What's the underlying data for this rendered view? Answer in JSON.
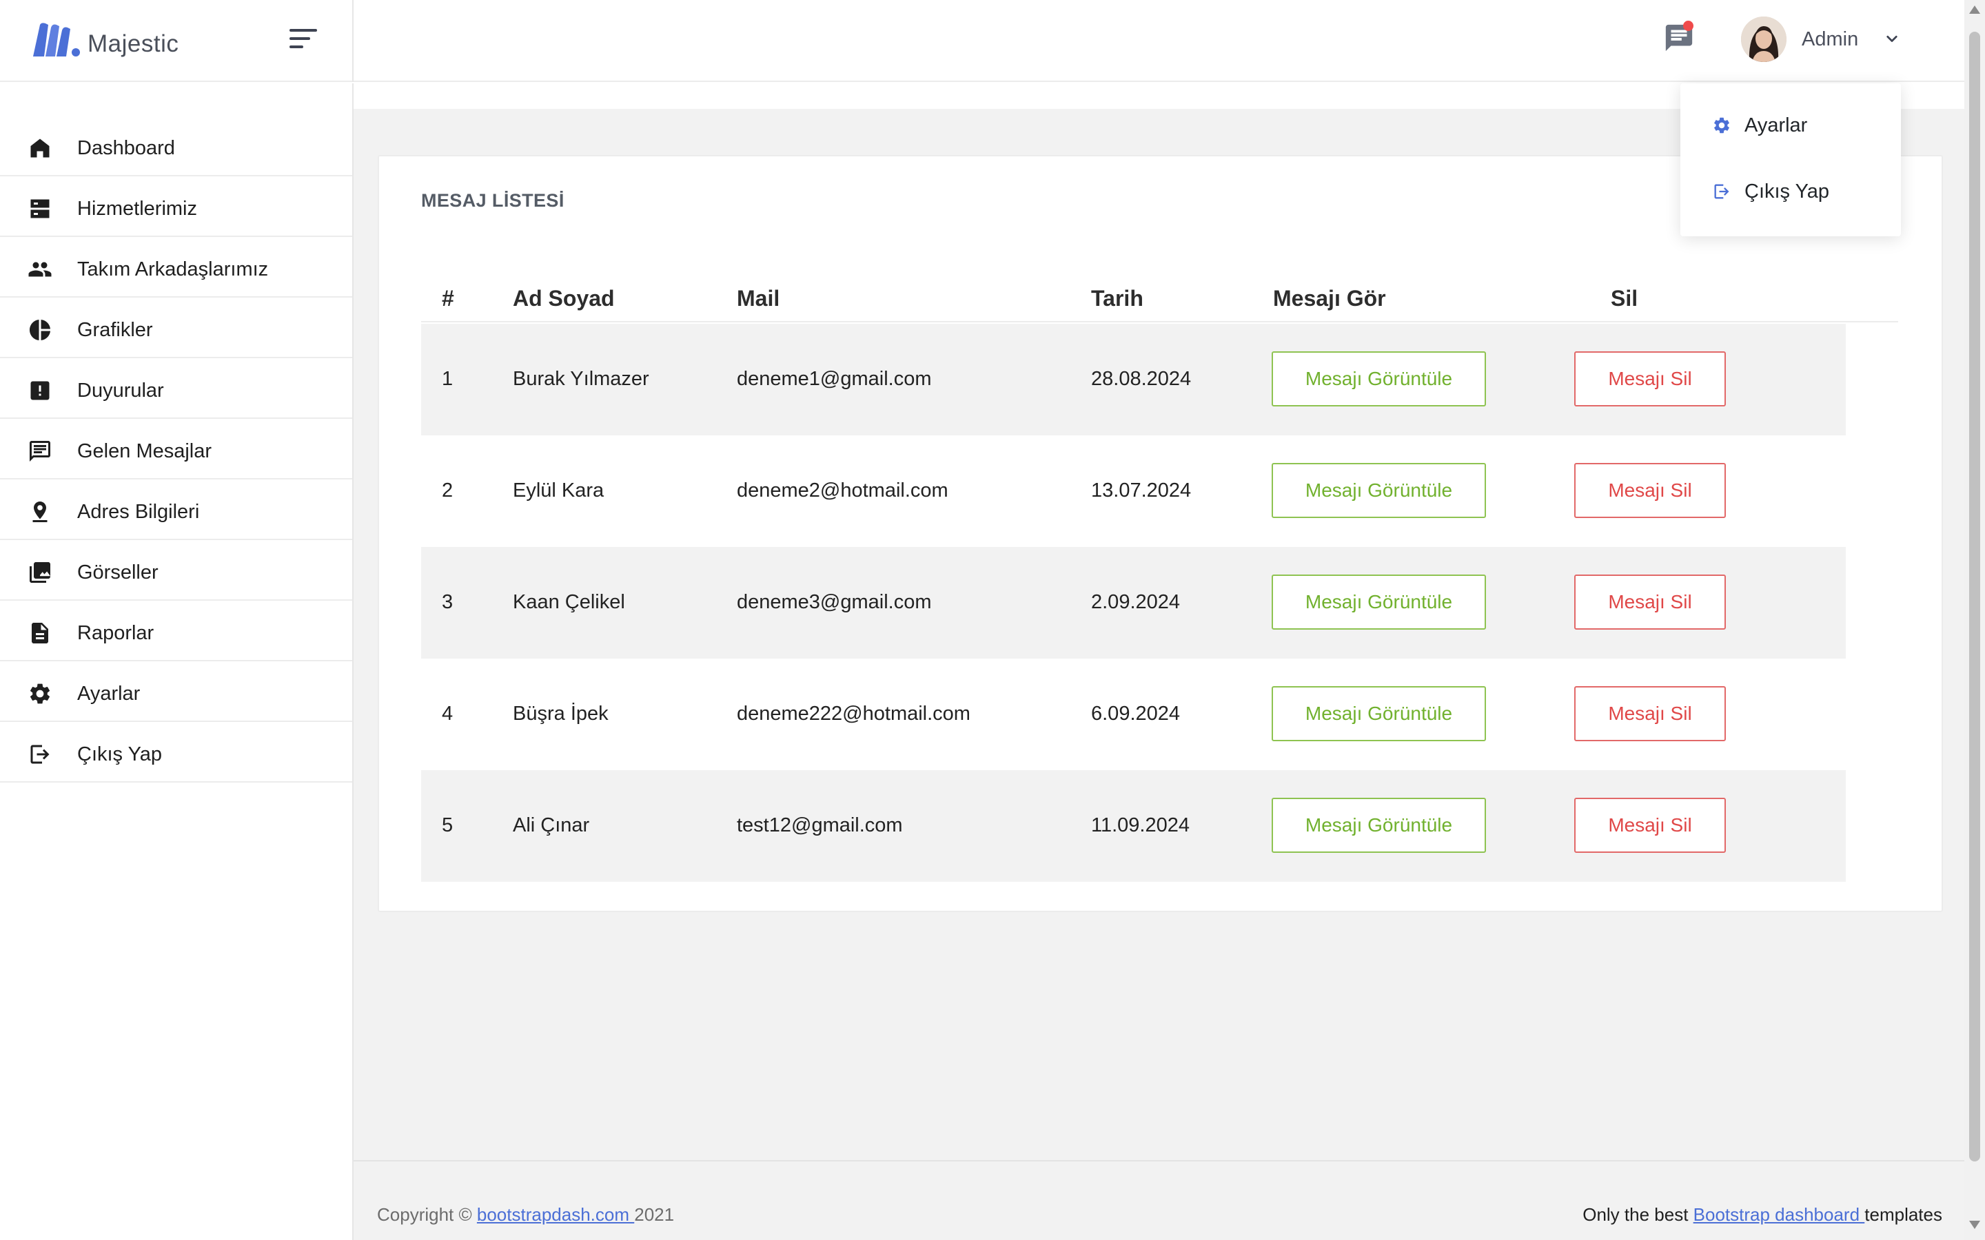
{
  "brand": {
    "name": "Majestic",
    "logo_color": "#4b6fd6"
  },
  "topbar": {
    "user_name": "Admin",
    "notification_dot_color": "#ef4b4b",
    "icons": [
      "menu-icon",
      "chat-icon",
      "chevron-down-icon"
    ]
  },
  "user_menu": {
    "items": [
      {
        "label": "Ayarlar",
        "icon": "gear-icon"
      },
      {
        "label": "Çıkış Yap",
        "icon": "logout-icon"
      }
    ]
  },
  "sidebar": {
    "items": [
      {
        "label": "Dashboard",
        "icon": "home-icon"
      },
      {
        "label": "Hizmetlerimiz",
        "icon": "server-icon"
      },
      {
        "label": "Takım Arkadaşlarımız",
        "icon": "people-icon"
      },
      {
        "label": "Grafikler",
        "icon": "pie-chart-icon"
      },
      {
        "label": "Duyurular",
        "icon": "alert-icon"
      },
      {
        "label": "Gelen Mesajlar",
        "icon": "message-icon"
      },
      {
        "label": "Adres Bilgileri",
        "icon": "location-icon"
      },
      {
        "label": "Görseller",
        "icon": "images-icon"
      },
      {
        "label": "Raporlar",
        "icon": "document-icon"
      },
      {
        "label": "Ayarlar",
        "icon": "gear-icon"
      },
      {
        "label": "Çıkış Yap",
        "icon": "logout-icon"
      }
    ]
  },
  "messages": {
    "title": "MESAJ LİSTESİ",
    "columns": {
      "index": "#",
      "name": "Ad Soyad",
      "mail": "Mail",
      "date": "Tarih",
      "view": "Mesajı Gör",
      "delete": "Sil"
    },
    "view_button_label": "Mesajı Görüntüle",
    "delete_button_label": "Mesajı Sil",
    "rows": [
      {
        "index": "1",
        "name": "Burak Yılmazer",
        "mail": "deneme1@gmail.com",
        "date": "28.08.2024",
        "view_label": "Mesajı Görüntüle",
        "delete_label": "Mesajı Sil"
      },
      {
        "index": "2",
        "name": "Eylül Kara",
        "mail": "deneme2@hotmail.com",
        "date": "13.07.2024",
        "view_label": "Mesajı Görüntüle",
        "delete_label": "Mesajı Sil"
      },
      {
        "index": "3",
        "name": "Kaan Çelikel",
        "mail": "deneme3@gmail.com",
        "date": "2.09.2024",
        "view_label": "Mesajı Görüntüle",
        "delete_label": "Mesajı Sil"
      },
      {
        "index": "4",
        "name": "Büşra İpek",
        "mail": "deneme222@hotmail.com",
        "date": "6.09.2024",
        "view_label": "Mesajı Görüntüle",
        "delete_label": "Mesajı Sil"
      },
      {
        "index": "5",
        "name": "Ali Çınar",
        "mail": "test12@gmail.com",
        "date": "11.09.2024",
        "view_label": "Mesajı Görüntüle",
        "delete_label": "Mesajı Sil"
      }
    ],
    "colors": {
      "view": "#71b12e",
      "delete": "#e04848",
      "stripe": "#f2f2f2"
    }
  },
  "footer": {
    "copyright_prefix": "Copyright © ",
    "copyright_link": "bootstrapdash.com ",
    "copyright_year": "2021",
    "right_prefix": "Only the best ",
    "right_link": "Bootstrap dashboard ",
    "right_suffix": "templates"
  }
}
